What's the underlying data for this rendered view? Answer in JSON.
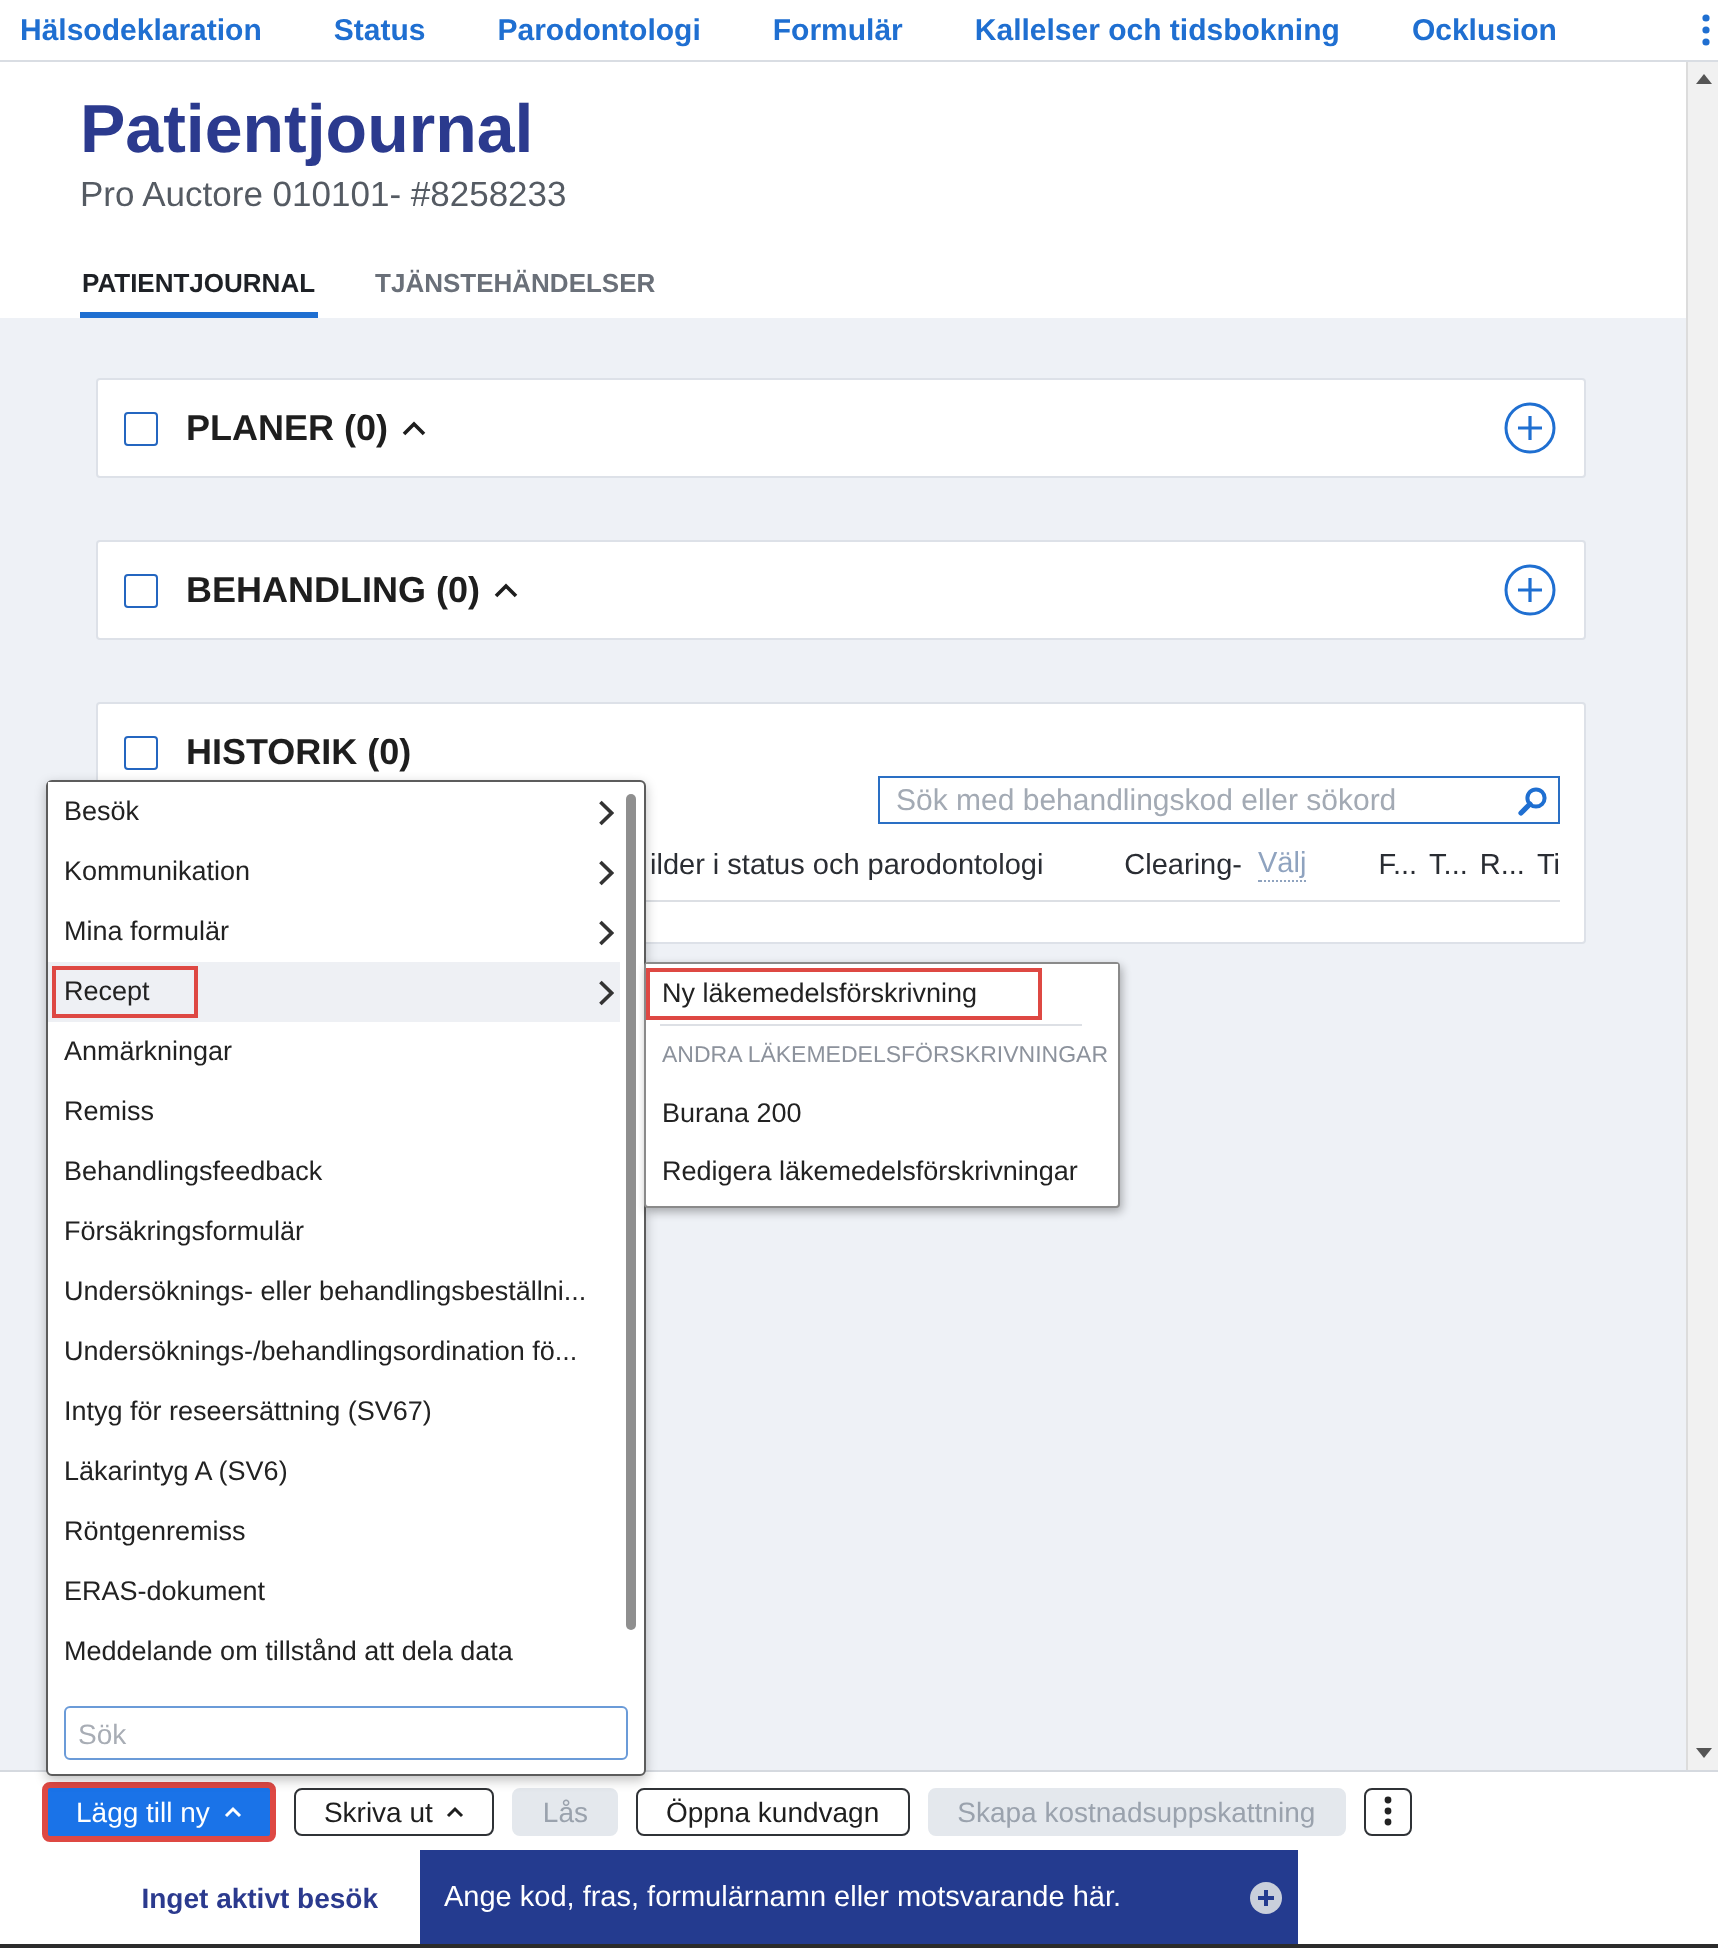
{
  "nav_links": [
    "Hälsodeklaration",
    "Status",
    "Parodontologi",
    "Formulär",
    "Kallelser och tidsbokning",
    "Ocklusion"
  ],
  "header": {
    "title": "Patientjournal",
    "subtitle": "Pro Auctore 010101- #8258233"
  },
  "tabs": [
    {
      "label": "PATIENTJOURNAL",
      "selected": true
    },
    {
      "label": "TJÄNSTEHÄNDELSER",
      "selected": false
    }
  ],
  "sections": [
    {
      "kind": "collapsible",
      "title": "PLANER (0)",
      "checked": false,
      "expanded": true
    },
    {
      "kind": "collapsible",
      "title": "BEHANDLING (0)",
      "checked": false,
      "expanded": true
    },
    {
      "kind": "history",
      "title": "HISTORIK (0)",
      "checked": false,
      "search": {
        "placeholder": "Sök med behandlingskod eller sökord"
      },
      "filter_label": "ilder i status och parodontologi",
      "clearing_label": "Clearing-",
      "clearing_select": "Välj",
      "columns": [
        "F...",
        "T...",
        "R...",
        "Ti"
      ]
    }
  ],
  "menu": {
    "items": [
      {
        "label": "Besök",
        "kind": "submenu",
        "selected": false,
        "marked": false
      },
      {
        "label": "Kommunikation",
        "kind": "submenu",
        "selected": false,
        "marked": false
      },
      {
        "label": "Mina formulär",
        "kind": "submenu",
        "selected": false,
        "marked": false
      },
      {
        "label": "Recept",
        "kind": "submenu",
        "selected": true,
        "marked": true
      },
      {
        "label": "Anmärkningar",
        "kind": "action",
        "selected": false,
        "marked": false
      },
      {
        "label": "Remiss",
        "kind": "action",
        "selected": false,
        "marked": false
      },
      {
        "label": "Behandlingsfeedback",
        "kind": "action",
        "selected": false,
        "marked": false
      },
      {
        "label": "Försäkringsformulär",
        "kind": "action",
        "selected": false,
        "marked": false
      },
      {
        "label": "Undersöknings- eller behandlingsbeställni...",
        "kind": "action",
        "selected": false,
        "marked": false
      },
      {
        "label": "Undersöknings-/behandlingsordination fö...",
        "kind": "action",
        "selected": false,
        "marked": false
      },
      {
        "label": "Intyg för reseersättning (SV67)",
        "kind": "action",
        "selected": false,
        "marked": false
      },
      {
        "label": "Läkarintyg A (SV6)",
        "kind": "action",
        "selected": false,
        "marked": false
      },
      {
        "label": "Röntgenremiss",
        "kind": "action",
        "selected": false,
        "marked": false
      },
      {
        "label": "ERAS-dokument",
        "kind": "action",
        "selected": false,
        "marked": false
      },
      {
        "label": "Meddelande om tillstånd att dela data",
        "kind": "action",
        "selected": false,
        "marked": false
      }
    ],
    "search": {
      "placeholder": "Sök"
    }
  },
  "submenu": {
    "items": [
      {
        "kind": "item",
        "label": "Ny läkemedelsförskrivning",
        "marked": true
      },
      {
        "kind": "separator"
      },
      {
        "kind": "heading",
        "label": "ANDRA LÄKEMEDELSFÖRSKRIVNINGAR"
      },
      {
        "kind": "item",
        "label": "Burana 200",
        "marked": false
      },
      {
        "kind": "item",
        "label": "Redigera läkemedelsförskrivningar",
        "marked": false
      }
    ]
  },
  "toolbar": {
    "buttons": [
      {
        "kind": "primary",
        "label": "Lägg till ny",
        "caret": true,
        "disabled": false,
        "marked": true
      },
      {
        "kind": "secondary",
        "label": "Skriva ut",
        "caret": true,
        "disabled": false,
        "marked": false
      },
      {
        "kind": "secondary",
        "label": "Lås",
        "caret": false,
        "disabled": true,
        "marked": false
      },
      {
        "kind": "secondary",
        "label": "Öppna kundvagn",
        "caret": false,
        "disabled": false,
        "marked": false
      },
      {
        "kind": "secondary",
        "label": "Skapa kostnadsuppskattning",
        "caret": false,
        "disabled": true,
        "marked": false
      },
      {
        "kind": "more",
        "caret": false,
        "disabled": false,
        "marked": false
      }
    ]
  },
  "footer": {
    "visit_status": "Inget aktivt besök",
    "command": {
      "placeholder": "Ange kod, fras, formulärnamn eller motsvarande här."
    }
  }
}
